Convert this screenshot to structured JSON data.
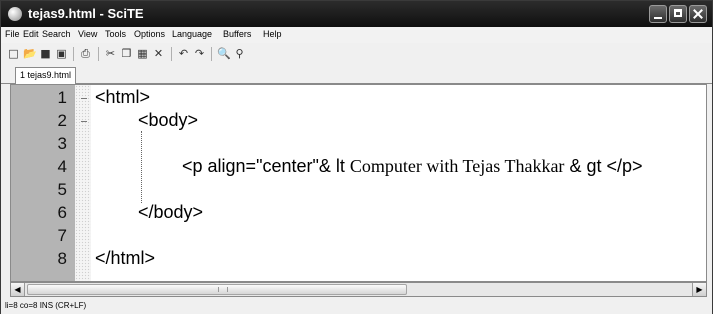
{
  "window": {
    "title": "tejas9.html - SciTE",
    "icon": "scite-app-icon"
  },
  "menubar": [
    "File",
    "Edit",
    "Search",
    "View",
    "Tools",
    "Options",
    "Language",
    "Buffers",
    "Help"
  ],
  "toolbar": [
    "new",
    "open",
    "save",
    "close",
    "print",
    "cut",
    "copy",
    "paste",
    "delete",
    "undo",
    "redo",
    "find",
    "replace"
  ],
  "tabs": [
    {
      "label": "1 tejas9.html",
      "active": true
    }
  ],
  "editor": {
    "line_numbers": [
      "1",
      "2",
      "3",
      "4",
      "5",
      "6",
      "7",
      "8"
    ],
    "lines": {
      "l1": "<html>",
      "l2": "<body>",
      "l4a": "<p align=\"center\"& lt ",
      "l4b": "Computer with Tejas Thakkar",
      "l4c": " & gt </p>",
      "l6": "</body>",
      "l8": "</html>"
    }
  },
  "statusbar": {
    "text": "li=8 co=8 INS (CR+LF)"
  }
}
